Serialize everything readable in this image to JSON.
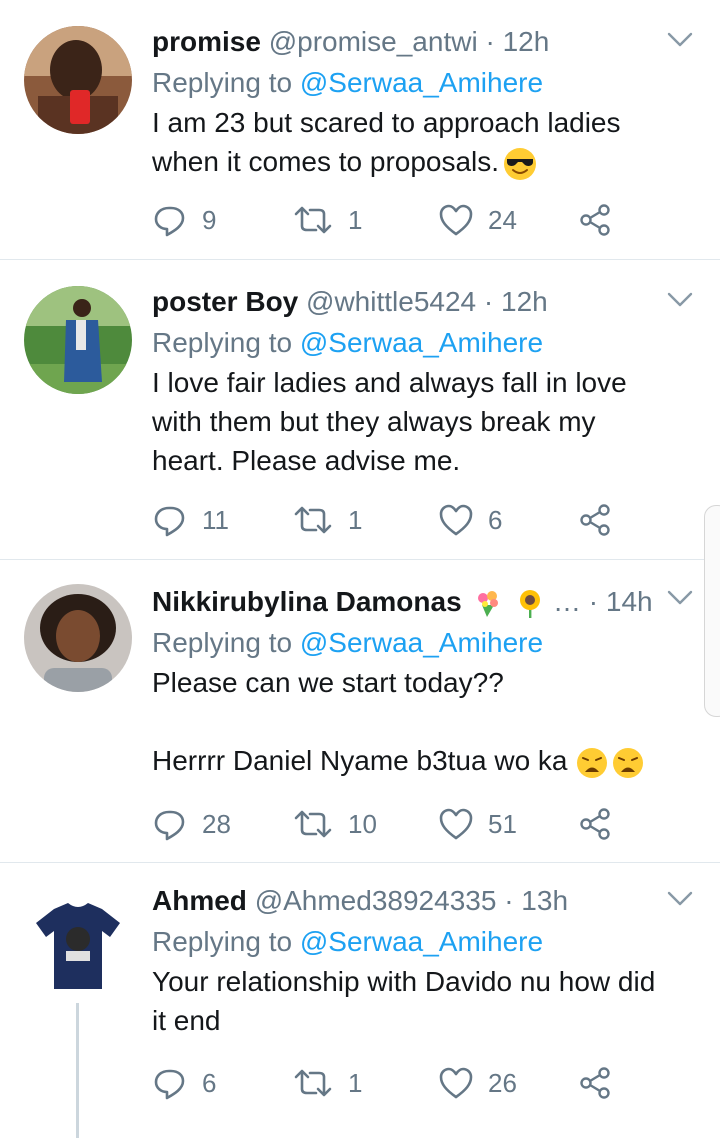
{
  "tweets": [
    {
      "name": "promise",
      "handle": "@promise_antwi",
      "time": "12h",
      "replying_prefix": "Replying to",
      "replying_to": "@Serwaa_Amihere",
      "lines": [
        "I am 23 but scared to approach ladies",
        "when it comes to proposals."
      ],
      "emoji": "smiling-face-with-sunglasses",
      "replies": "9",
      "retweets": "1",
      "likes": "24"
    },
    {
      "name": "poster Boy",
      "handle": "@whittle5424",
      "time": "12h",
      "replying_prefix": "Replying to",
      "replying_to": "@Serwaa_Amihere",
      "lines": [
        "I love fair ladies and always fall in love",
        "with them but they always break my",
        "heart. Please advise me."
      ],
      "replies": "11",
      "retweets": "1",
      "likes": "6"
    },
    {
      "name": "Nikkirubylina Damonas",
      "handle": "…",
      "time": "14h",
      "replying_prefix": "Replying to",
      "replying_to": "@Serwaa_Amihere",
      "lines": [
        "Please can we start today??",
        "Herrrr Daniel Nyame b3tua wo ka"
      ],
      "name_emojis": [
        "bouquet",
        "sunflower"
      ],
      "text_emojis": [
        "weary-face",
        "weary-face"
      ],
      "replies": "28",
      "retweets": "10",
      "likes": "51"
    },
    {
      "name": "Ahmed",
      "handle": "@Ahmed38924335",
      "time": "13h",
      "replying_prefix": "Replying to",
      "replying_to": "@Serwaa_Amihere",
      "lines": [
        "Your relationship with Davido nu how did",
        "it end"
      ],
      "replies": "6",
      "retweets": "1",
      "likes": "26"
    }
  ],
  "separator": "·",
  "colors": {
    "name": "#14171a",
    "meta": "#657786",
    "mention": "#1da1f2",
    "divider": "#e1e8ed",
    "icon": "#657786"
  }
}
